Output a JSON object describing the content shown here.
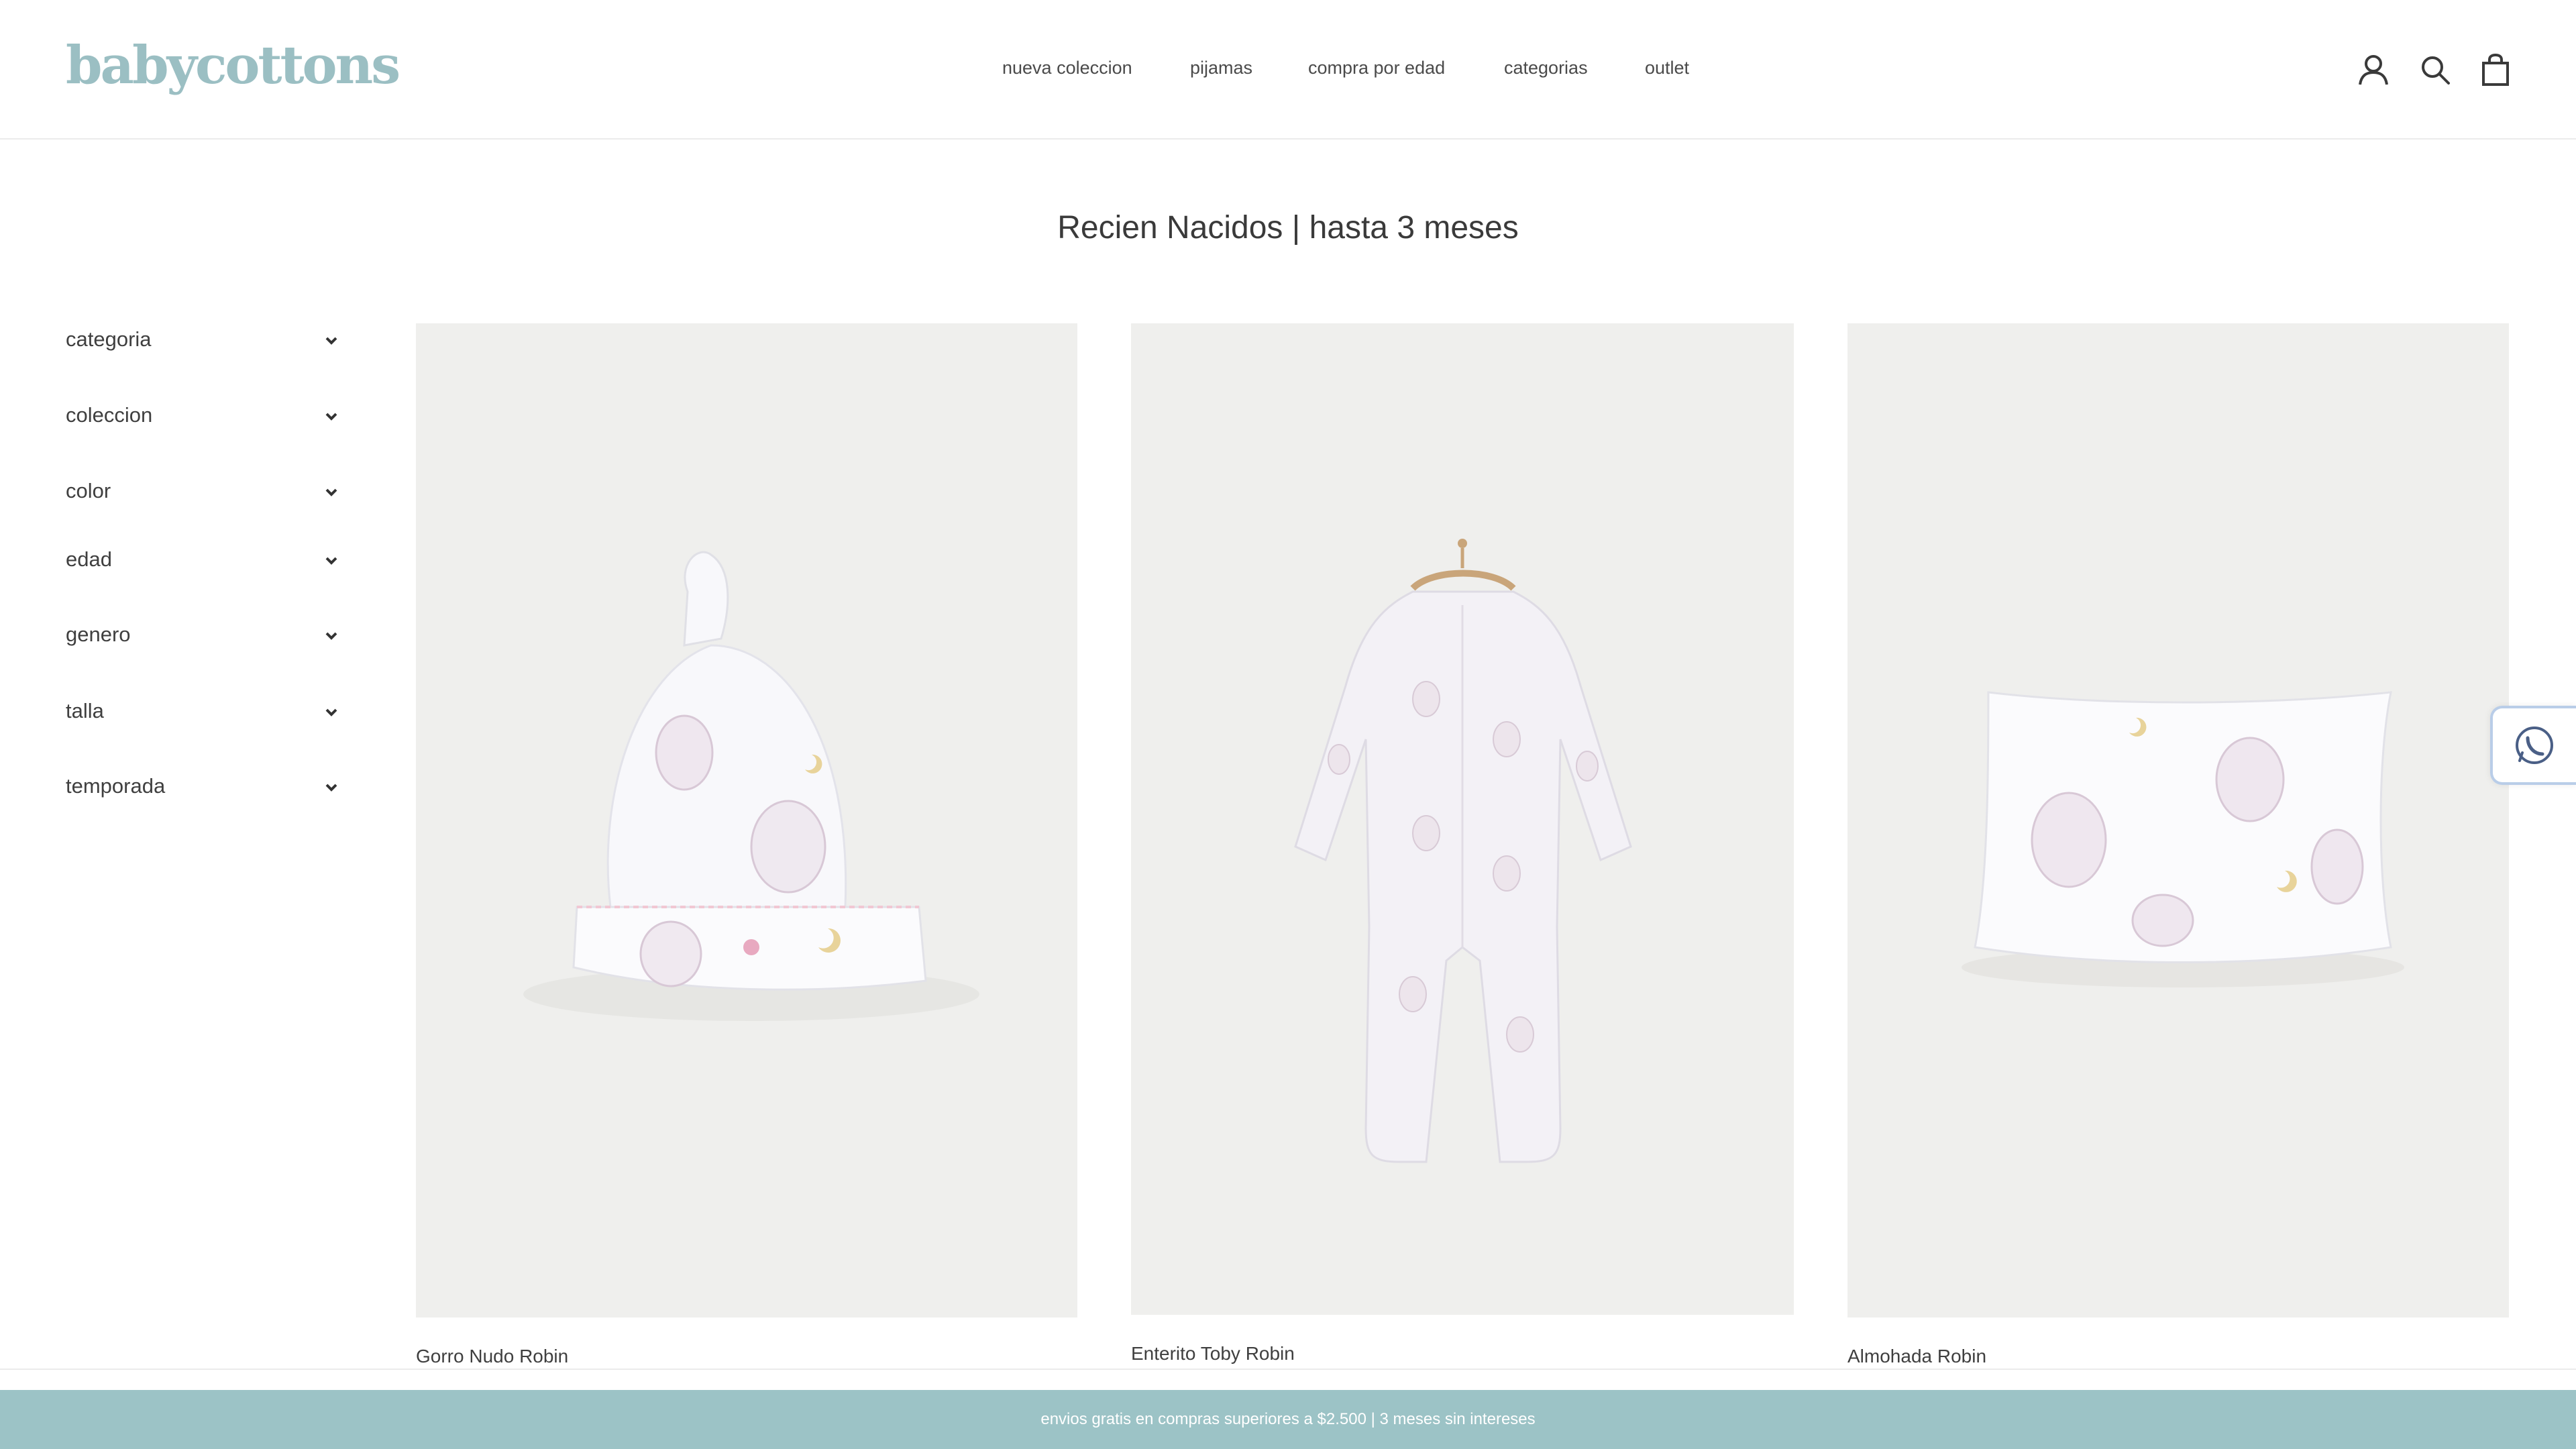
{
  "brand": {
    "logo_text": "babycottons",
    "color": "#9bbfc3"
  },
  "nav": {
    "items": [
      "nueva coleccion",
      "pijamas",
      "compra por edad",
      "categorias",
      "outlet"
    ]
  },
  "header_icons": [
    "account-icon",
    "search-icon",
    "cart-icon"
  ],
  "page": {
    "title": "Recien Nacidos | hasta 3 meses"
  },
  "filters": [
    "categoria",
    "coleccion",
    "color",
    "edad",
    "genero",
    "talla",
    "temporada"
  ],
  "products": [
    {
      "name": "Gorro Nudo Robin",
      "image": "knot-hat"
    },
    {
      "name": "Enterito Toby Robin",
      "image": "footed-onesie"
    },
    {
      "name": "Almohada Robin",
      "image": "pillow"
    }
  ],
  "floating": {
    "icon": "whatsapp-icon"
  },
  "promo_bar": {
    "text": "envios gratis en compras superiores a $2.500 | 3 meses sin intereses",
    "color": "#9cc3c6"
  }
}
